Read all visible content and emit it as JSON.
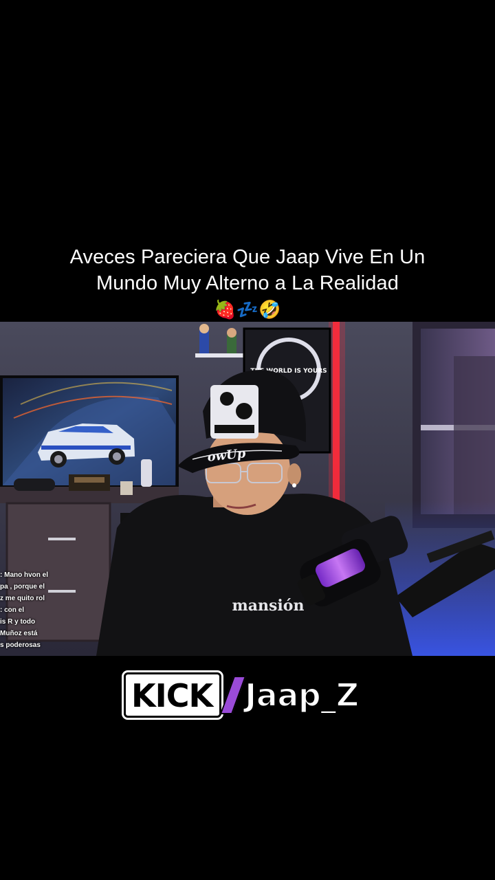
{
  "caption": {
    "line1": "Aveces Pareciera Que Jaap Vive En Un",
    "line2": "Mundo Muy Alterno a La Realidad",
    "emoji": "🍓💤🤣"
  },
  "video": {
    "shirt_text": "mansión",
    "cap_text": "owUp",
    "poster_text": "THE WORLD IS YOURS"
  },
  "chat": [
    {
      "user": "",
      "text": ": Mano hvon el"
    },
    {
      "user": "",
      "text": "pa , porque el"
    },
    {
      "user": "",
      "text": "z me quito rol"
    },
    {
      "user": "",
      "text": ": con el"
    },
    {
      "user": "",
      "text": "is R y todo"
    },
    {
      "user": "",
      "text": "Muñoz está"
    },
    {
      "user": "",
      "text": "s poderosas"
    }
  ],
  "brand": {
    "platform": "KICK",
    "username": "Jaap_Z"
  },
  "colors": {
    "background": "#000000",
    "kick_slash": "#9a4bd8",
    "neon_red": "#ff2a3a",
    "neon_blue": "#3b5bff",
    "mic_purple": "#b04cff"
  }
}
